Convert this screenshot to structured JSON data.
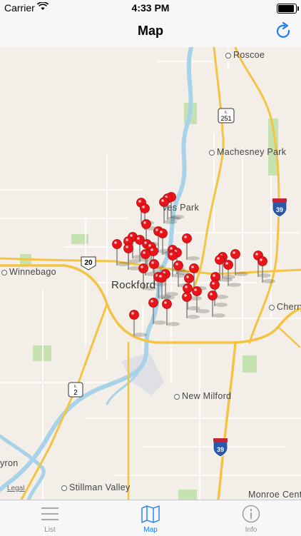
{
  "status_bar": {
    "carrier": "Carrier",
    "time": "4:33 PM"
  },
  "nav": {
    "title": "Map",
    "refresh_icon": "refresh-icon"
  },
  "map": {
    "labels": {
      "roscoe": "Roscoe",
      "machesney_park": "Machesney Park",
      "loves_park": "ves Park",
      "winnebago": "Winnebago",
      "rockford": "Rockford",
      "cherry_valley": "Cherry",
      "new_milford": "New Milford",
      "stillman_valley": "Stillman Valley",
      "monroe_center": "Monroe Center",
      "byron": "yron"
    },
    "shields": {
      "il251": "251",
      "il251_state": "IL",
      "us20": "20",
      "i39_north": "39",
      "il2": "2",
      "il2_state": "IL",
      "i39_south": "39"
    },
    "legal": "Legal",
    "pin_color": "#e8141a",
    "road_color": "#f5c343",
    "water_color": "#a7d2e8",
    "park_color": "#c6e2b0"
  },
  "tabs": [
    {
      "label": "List",
      "icon": "list-icon"
    },
    {
      "label": "Map",
      "icon": "map-icon"
    },
    {
      "label": "Info",
      "icon": "info-icon"
    }
  ],
  "active_tab": "Map",
  "accent_color": "#1a7cf5"
}
